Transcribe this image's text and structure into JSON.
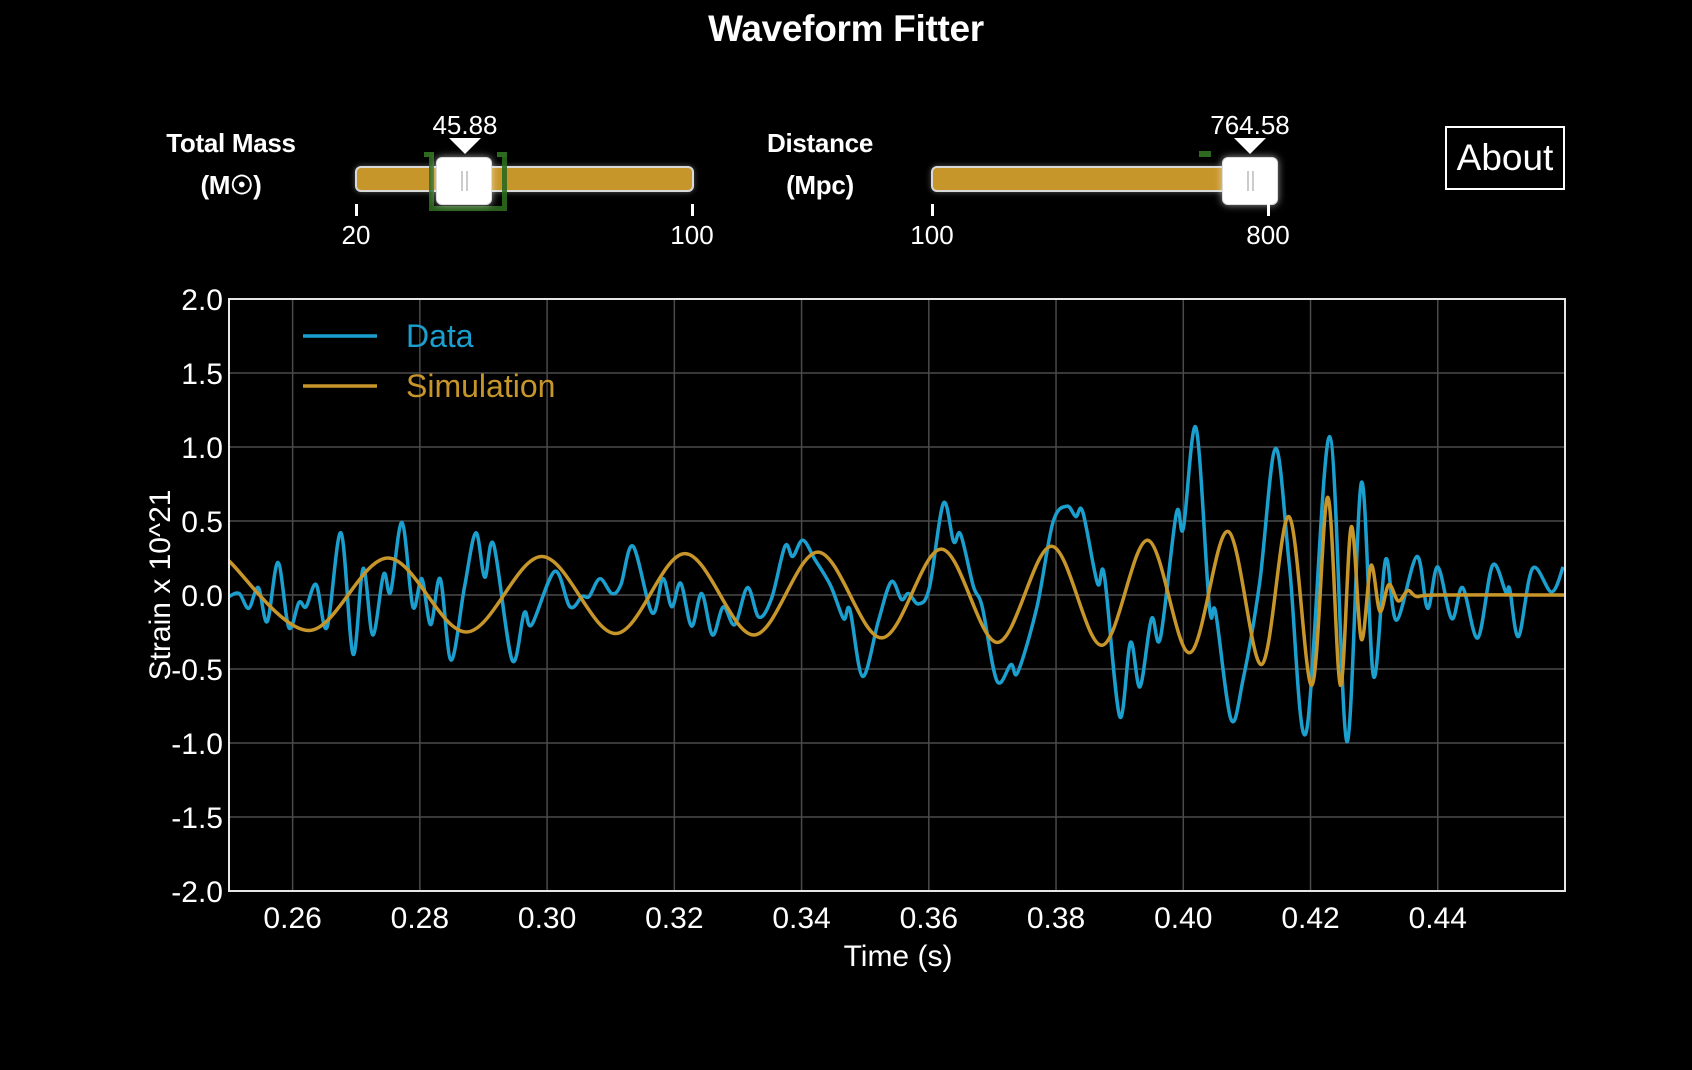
{
  "app": {
    "title": "Waveform Fitter"
  },
  "controls": {
    "mass": {
      "label_line1": "Total Mass",
      "label_line2": "(M☉)",
      "min": 20,
      "max": 100,
      "min_label": "20",
      "max_label": "100",
      "value": 45.88,
      "value_label": "45.88"
    },
    "distance": {
      "label_line1": "Distance",
      "label_line2": "(Mpc)",
      "min": 100,
      "max": 800,
      "min_label": "100",
      "max_label": "800",
      "value": 764.58,
      "value_label": "764.58"
    },
    "about_label": "About"
  },
  "colors": {
    "background": "#000000",
    "data": "#1b9fcf",
    "simulation": "#c7962a",
    "slider_fill": "#c7962a",
    "bracket": "#2d6a1f",
    "grid": "#4a4a4a"
  },
  "chart_data": {
    "type": "line",
    "title": "",
    "xlabel": "Time (s)",
    "ylabel": "Strain x 10^21",
    "xlim": [
      0.25,
      0.46
    ],
    "ylim": [
      -2.0,
      2.0
    ],
    "grid": true,
    "legend_position": "top-left",
    "xticks": [
      0.26,
      0.28,
      0.3,
      0.32,
      0.34,
      0.36,
      0.38,
      0.4,
      0.42,
      0.44
    ],
    "xtick_labels": [
      "0.26",
      "0.28",
      "0.30",
      "0.32",
      "0.34",
      "0.36",
      "0.38",
      "0.40",
      "0.42",
      "0.44"
    ],
    "yticks": [
      2.0,
      1.5,
      1.0,
      0.5,
      0.0,
      -0.5,
      -1.0,
      -1.5,
      -2.0
    ],
    "ytick_labels": [
      "2.0",
      "1.5",
      "1.0",
      "0.5",
      "0.0",
      "-0.5",
      "-1.0",
      "-1.5",
      "-2.0"
    ],
    "series": [
      {
        "name": "Data",
        "x": [
          0.25,
          0.2516,
          0.2531,
          0.2546,
          0.256,
          0.2577,
          0.2594,
          0.261,
          0.2621,
          0.2637,
          0.2654,
          0.2676,
          0.2695,
          0.2711,
          0.2726,
          0.2743,
          0.2754,
          0.2772,
          0.2789,
          0.2803,
          0.2817,
          0.2832,
          0.2849,
          0.287,
          0.2888,
          0.2902,
          0.2916,
          0.2945,
          0.2964,
          0.2976,
          0.3012,
          0.3036,
          0.3055,
          0.3066,
          0.3083,
          0.3102,
          0.3116,
          0.3135,
          0.3165,
          0.3182,
          0.3196,
          0.321,
          0.3227,
          0.3243,
          0.326,
          0.3277,
          0.3295,
          0.3315,
          0.3333,
          0.3353,
          0.3374,
          0.3386,
          0.3402,
          0.3421,
          0.3446,
          0.3466,
          0.3476,
          0.3496,
          0.3521,
          0.3541,
          0.3557,
          0.3568,
          0.3584,
          0.3601,
          0.3623,
          0.3639,
          0.365,
          0.367,
          0.3684,
          0.3707,
          0.3729,
          0.374,
          0.377,
          0.3795,
          0.3817,
          0.3831,
          0.3842,
          0.3865,
          0.3876,
          0.39,
          0.3917,
          0.3932,
          0.395,
          0.3964,
          0.3989,
          0.4,
          0.402,
          0.4041,
          0.4051,
          0.4075,
          0.4094,
          0.412,
          0.4145,
          0.4167,
          0.4193,
          0.423,
          0.4257,
          0.428,
          0.4299,
          0.4318,
          0.4335,
          0.4367,
          0.4384,
          0.44,
          0.4422,
          0.4439,
          0.4463,
          0.4486,
          0.4507,
          0.4513,
          0.4527,
          0.4549,
          0.4579,
          0.4597
        ],
        "y": [
          -0.01,
          0.01,
          -0.09,
          0.05,
          -0.18,
          0.22,
          -0.22,
          -0.05,
          -0.08,
          0.07,
          -0.22,
          0.42,
          -0.4,
          0.18,
          -0.27,
          0.14,
          0.02,
          0.49,
          -0.08,
          0.11,
          -0.2,
          0.11,
          -0.44,
          0.05,
          0.42,
          0.12,
          0.34,
          -0.44,
          -0.12,
          -0.2,
          0.16,
          -0.08,
          -0.01,
          -0.01,
          0.11,
          0.01,
          0.07,
          0.33,
          -0.12,
          0.11,
          -0.08,
          0.08,
          -0.21,
          0.01,
          -0.27,
          -0.08,
          -0.2,
          0.05,
          -0.15,
          -0.02,
          0.33,
          0.26,
          0.37,
          0.24,
          0.06,
          -0.16,
          -0.1,
          -0.55,
          -0.17,
          0.09,
          -0.03,
          0.01,
          -0.06,
          0.05,
          0.62,
          0.36,
          0.41,
          0.06,
          -0.08,
          -0.58,
          -0.47,
          -0.52,
          -0.08,
          0.49,
          0.6,
          0.53,
          0.56,
          0.08,
          0.13,
          -0.82,
          -0.32,
          -0.62,
          -0.16,
          -0.29,
          0.55,
          0.45,
          1.13,
          -0.08,
          -0.12,
          -0.84,
          -0.57,
          0.08,
          0.99,
          0.19,
          -0.93,
          1.07,
          -0.99,
          0.76,
          -0.55,
          0.24,
          -0.17,
          0.26,
          -0.09,
          0.19,
          -0.16,
          0.05,
          -0.29,
          0.2,
          0.02,
          0.04,
          -0.28,
          0.18,
          0.02,
          0.19
        ]
      },
      {
        "name": "Simulation",
        "x": [
          0.25,
          0.2626,
          0.275,
          0.2873,
          0.2992,
          0.3108,
          0.3217,
          0.3325,
          0.3426,
          0.3526,
          0.362,
          0.3708,
          0.3793,
          0.3872,
          0.3944,
          0.401,
          0.407,
          0.4123,
          0.4166,
          0.4202,
          0.4227,
          0.4247,
          0.4264,
          0.428,
          0.4295,
          0.4309,
          0.4323,
          0.4338,
          0.4353,
          0.4367,
          0.44,
          0.46
        ],
        "y": [
          0.23,
          -0.24,
          0.25,
          -0.25,
          0.26,
          -0.26,
          0.28,
          -0.27,
          0.29,
          -0.29,
          0.31,
          -0.32,
          0.33,
          -0.34,
          0.37,
          -0.39,
          0.43,
          -0.47,
          0.53,
          -0.61,
          0.66,
          -0.61,
          0.46,
          -0.3,
          0.2,
          -0.11,
          0.07,
          -0.04,
          0.03,
          -0.01,
          0.0,
          0.0
        ]
      }
    ]
  }
}
